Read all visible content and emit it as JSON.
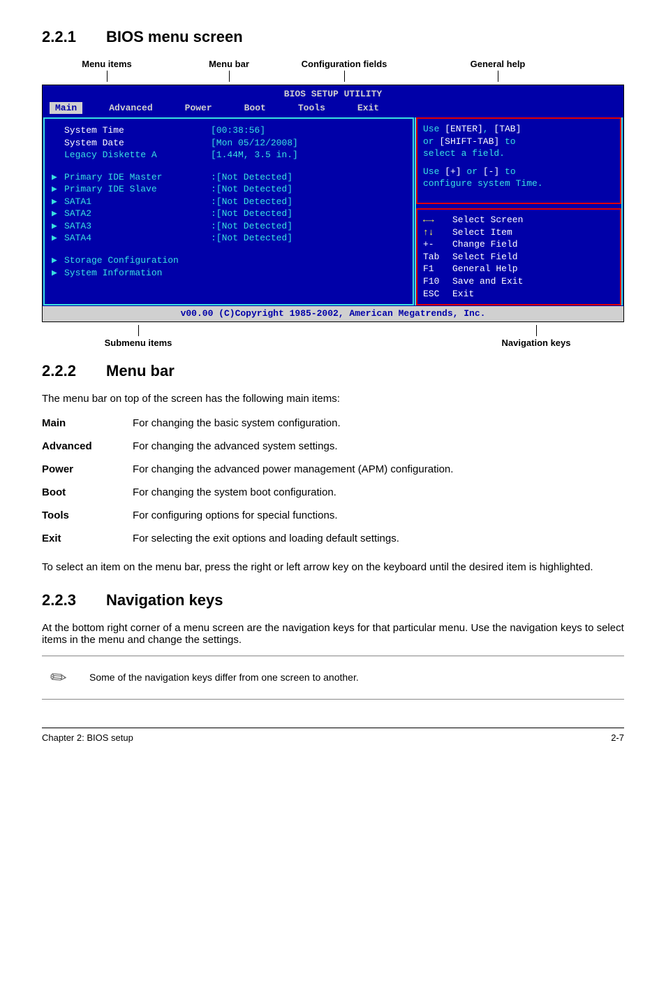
{
  "sections": {
    "s1": {
      "num": "2.2.1",
      "title": "BIOS menu screen"
    },
    "s2": {
      "num": "2.2.2",
      "title": "Menu bar"
    },
    "s3": {
      "num": "2.2.3",
      "title": "Navigation keys"
    }
  },
  "annot": {
    "menu_items": "Menu items",
    "menu_bar": "Menu bar",
    "config_fields": "Configuration fields",
    "general_help": "General help",
    "submenu_items": "Submenu items",
    "nav_keys": "Navigation keys"
  },
  "bios": {
    "title": "BIOS SETUP UTILITY",
    "tabs": {
      "main": "Main",
      "advanced": "Advanced",
      "power": "Power",
      "boot": "Boot",
      "tools": "Tools",
      "exit": "Exit"
    },
    "rows": {
      "system_time": {
        "label": "System Time",
        "hour": "00",
        "rest": ":38:56]"
      },
      "system_date": {
        "label": "System Date",
        "val": "[Mon 05/12/2008]"
      },
      "legacy": {
        "label": "Legacy Diskette A",
        "val": "[1.44M, 3.5 in.]"
      },
      "pmaster": {
        "label": "Primary IDE Master",
        "val": ":[Not Detected]"
      },
      "pslave": {
        "label": "Primary IDE Slave",
        "val": ":[Not Detected]"
      },
      "sata1": {
        "label": "SATA1",
        "val": ":[Not Detected]"
      },
      "sata2": {
        "label": "SATA2",
        "val": ":[Not Detected]"
      },
      "sata3": {
        "label": "SATA3",
        "val": ":[Not Detected]"
      },
      "sata4": {
        "label": "SATA4",
        "val": ":[Not Detected]"
      },
      "storage": {
        "label": "Storage Configuration"
      },
      "sysinfo": {
        "label": "System Information"
      }
    },
    "help": {
      "l1a": "Use ",
      "l1b": "[ENTER]",
      "l1c": ", ",
      "l1d": "[TAB]",
      "l2a": "or ",
      "l2b": "[SHIFT-TAB]",
      "l2c": " to",
      "l3": "select a field.",
      "l4a": "Use ",
      "l4b": "[+]",
      "l4c": " or ",
      "l4d": "[-]",
      "l4e": " to",
      "l5": "configure system Time."
    },
    "nav": {
      "r1": {
        "k": "←→",
        "d": "Select Screen"
      },
      "r2": {
        "k": "↑↓",
        "d": "Select Item"
      },
      "r3": {
        "k": "+-",
        "d": "Change Field"
      },
      "r4": {
        "k": "Tab",
        "d": "Select Field"
      },
      "r5": {
        "k": "F1",
        "d": "General Help"
      },
      "r6": {
        "k": "F10",
        "d": "Save and Exit"
      },
      "r7": {
        "k": "ESC",
        "d": "Exit"
      }
    },
    "footer": "v00.00 (C)Copyright 1985-2002, American Megatrends, Inc."
  },
  "menubar_intro": "The menu bar on top of the screen has the following main items:",
  "defs": {
    "main": {
      "term": "Main",
      "desc": "For changing the basic system configuration."
    },
    "advanced": {
      "term": "Advanced",
      "desc": "For changing the advanced system settings."
    },
    "power": {
      "term": "Power",
      "desc": "For changing the advanced power management (APM) configuration."
    },
    "boot": {
      "term": "Boot",
      "desc": "For changing the system boot configuration."
    },
    "tools": {
      "term": "Tools",
      "desc": "For configuring options for special functions."
    },
    "exit": {
      "term": "Exit",
      "desc": "For selecting the exit options and loading default settings."
    }
  },
  "menubar_outro": "To select an item on the menu bar, press the right or left arrow key on the keyboard until the desired item is highlighted.",
  "navkeys_para": "At the bottom right corner of a menu screen are the navigation keys for that particular menu. Use the navigation keys to select items in the menu and change the settings.",
  "note": "Some of the navigation keys differ from one screen to another.",
  "footer": {
    "left": "Chapter 2: BIOS setup",
    "right": "2-7"
  }
}
